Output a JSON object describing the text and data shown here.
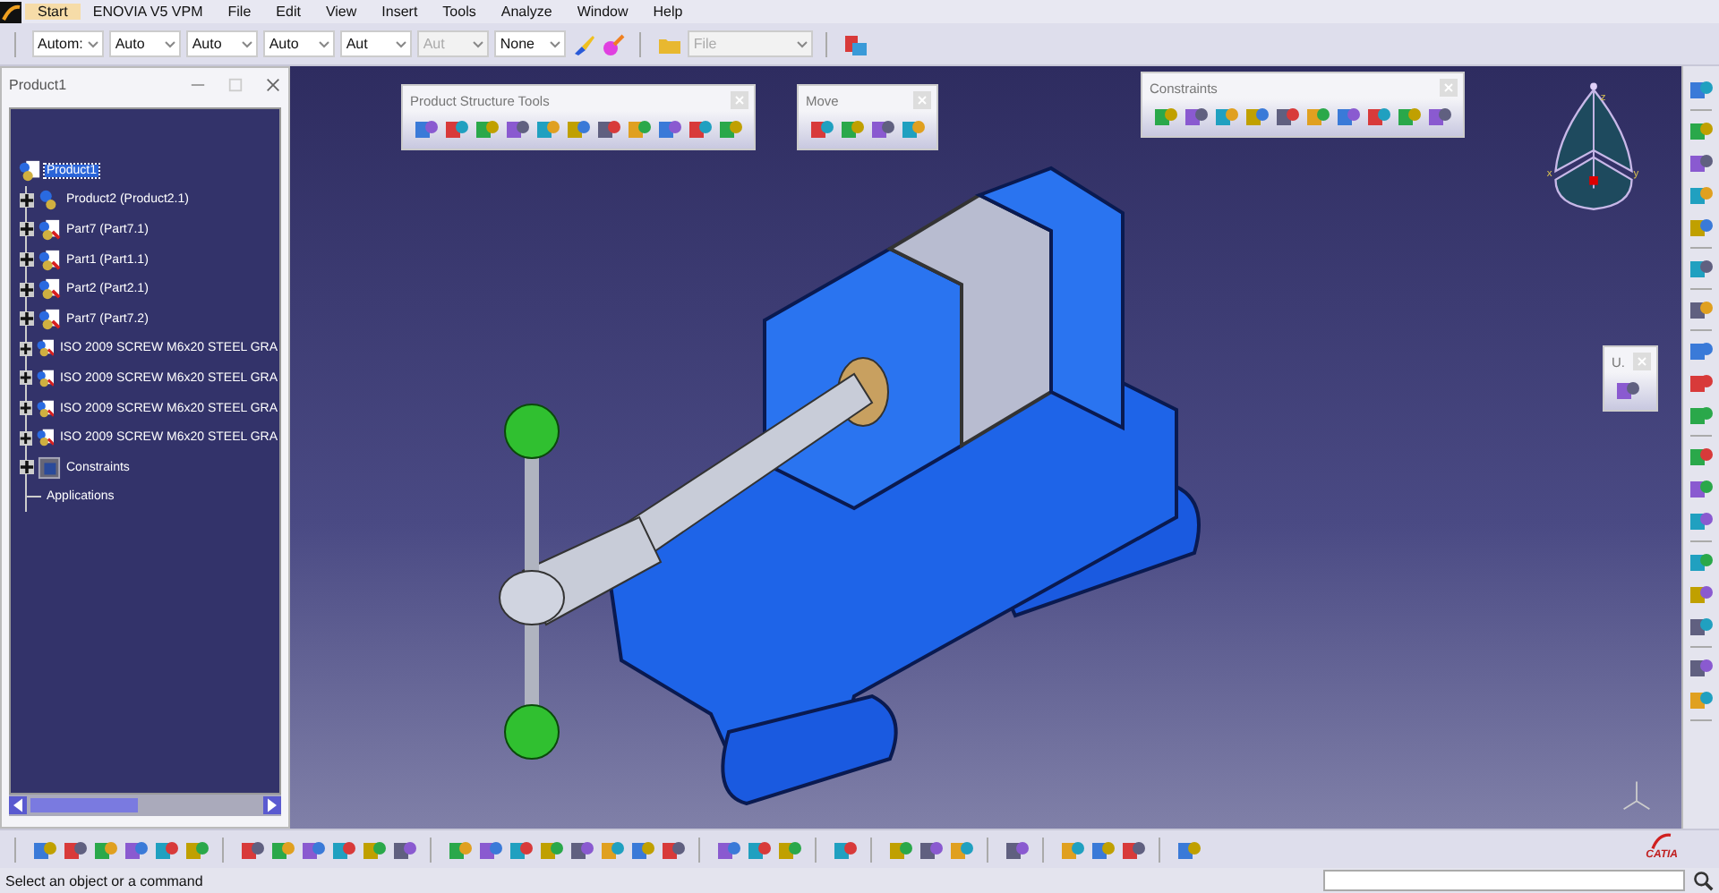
{
  "menu": [
    {
      "label": "Start",
      "selected": true
    },
    {
      "label": "ENOVIA V5 VPM",
      "selected": false
    },
    {
      "label": "File",
      "selected": false
    },
    {
      "label": "Edit",
      "selected": false
    },
    {
      "label": "View",
      "selected": false
    },
    {
      "label": "Insert",
      "selected": false
    },
    {
      "label": "Tools",
      "selected": false
    },
    {
      "label": "Analyze",
      "selected": false
    },
    {
      "label": "Window",
      "selected": false
    },
    {
      "label": "Help",
      "selected": false
    }
  ],
  "combos": [
    {
      "value": "Autom:",
      "disabled": false
    },
    {
      "value": "Auto",
      "disabled": false
    },
    {
      "value": "Auto",
      "disabled": false
    },
    {
      "value": "Auto",
      "disabled": false
    },
    {
      "value": "Aut",
      "disabled": false
    },
    {
      "value": "Aut",
      "disabled": true
    },
    {
      "value": "None",
      "disabled": false
    }
  ],
  "file_combo": {
    "value": "File",
    "disabled": true
  },
  "tree_window": {
    "title": "Product1",
    "root": {
      "label": "Product1",
      "kind": "product",
      "selected": true,
      "children": [
        {
          "label": "Product2 (Product2.1)",
          "kind": "product",
          "selected": false
        },
        {
          "label": "Part7 (Part7.1)",
          "kind": "part",
          "selected": false
        },
        {
          "label": "Part1 (Part1.1)",
          "kind": "part",
          "selected": false
        },
        {
          "label": "Part2 (Part2.1)",
          "kind": "part",
          "selected": false
        },
        {
          "label": "Part7 (Part7.2)",
          "kind": "part",
          "selected": false
        },
        {
          "label": "ISO 2009 SCREW M6x20 STEEL GRA",
          "kind": "part",
          "selected": false
        },
        {
          "label": "ISO 2009 SCREW M6x20 STEEL GRA",
          "kind": "part",
          "selected": false
        },
        {
          "label": "ISO 2009 SCREW M6x20 STEEL GRA",
          "kind": "part",
          "selected": false
        },
        {
          "label": "ISO 2009 SCREW M6x20 STEEL GRA",
          "kind": "part",
          "selected": false
        },
        {
          "label": "Constraints",
          "kind": "constraints",
          "selected": false
        },
        {
          "label": "Applications",
          "kind": "applications",
          "selected": false
        }
      ]
    }
  },
  "floating_toolbars": [
    {
      "title": "Product Structure Tools"
    },
    {
      "title": "Move"
    },
    {
      "title": "Constraints"
    },
    {
      "title": "U."
    }
  ],
  "compass": {
    "axes": [
      "z",
      "x",
      "y"
    ]
  },
  "logo": "CATIA",
  "status_bar": {
    "message": "Select an object or a command"
  }
}
